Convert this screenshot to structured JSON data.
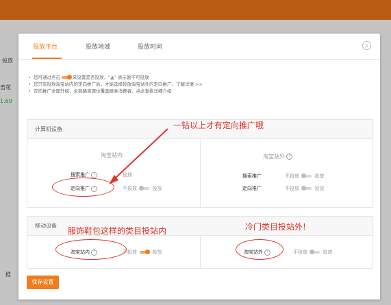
{
  "tabs": [
    {
      "label": "投放平台",
      "active": true
    },
    {
      "label": "投放地域",
      "active": false
    },
    {
      "label": "投放时间",
      "active": false
    }
  ],
  "background": {
    "tab_label": "投放",
    "link_text": "击花",
    "percent": "1.69",
    "bottom_char": "推"
  },
  "notice": {
    "line1_pre": "您可通过点击",
    "line1_mid": "来设置是否投放，\"",
    "line1_post": "\" 表示暂不可投放",
    "line2": "您只有投放淘宝站内的定向推广后，才能选择投放淘宝站外的定向推广，了解详情 >>",
    "line3": "定向推广全面升级，全链路资源位覆盖精准消费者。点此查看详细介绍"
  },
  "pc": {
    "header": "计算机设备",
    "inside_title": "淘宝站内",
    "outside_title": "淘宝站外",
    "inside_rows": [
      {
        "name": "搜索推广",
        "state_label": "投放"
      },
      {
        "name": "定向推广",
        "off_label": "不投放",
        "on_label": "投放"
      }
    ],
    "outside_rows": [
      {
        "name": "搜索推广",
        "off_label": "不投放",
        "on_label": "投放"
      },
      {
        "name": "定向推广",
        "off_label": "不投放",
        "on_label": "投放"
      }
    ]
  },
  "mobile": {
    "header": "移动设备",
    "inside": {
      "name": "淘宝站内",
      "off_label": "不投放",
      "on_label": "投放"
    },
    "outside": {
      "name": "淘宝站外",
      "off_label": "不投放",
      "on_label": "投放"
    }
  },
  "annotations": {
    "a1": "一钻以上才有定向推广哦",
    "a2": "服饰鞋包这样的类目投站内",
    "a3": "冷门类目投站外!"
  },
  "save_label": "保存设置",
  "accent": "#f07d1e",
  "annotation_color": "#e0332a"
}
